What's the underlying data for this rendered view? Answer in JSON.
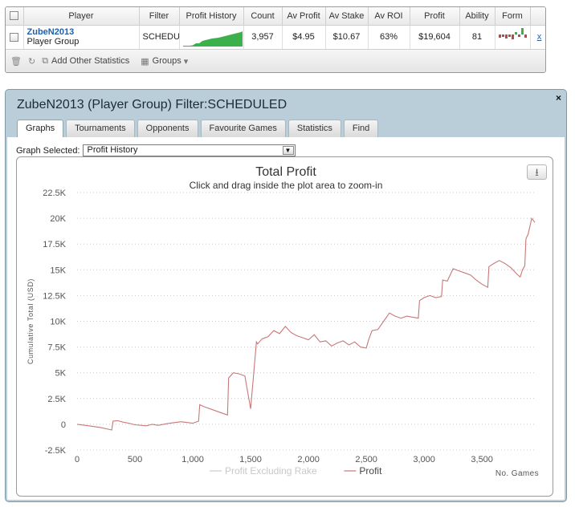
{
  "stats": {
    "headers": [
      "Player",
      "Filter",
      "Profit History",
      "Count",
      "Av Profit",
      "Av Stake",
      "Av ROI",
      "Profit",
      "Ability",
      "Form"
    ],
    "row": {
      "player_name": "ZubeN2013",
      "player_type": "Player Group",
      "filter": "SCHEDULED",
      "count": "3,957",
      "av_profit": "$4.95",
      "av_stake": "$10.67",
      "av_roi": "63%",
      "profit": "$19,604",
      "ability": "81",
      "remove": "x"
    },
    "form_colors": {
      "negative": "#b84a4a",
      "positive": "#3cb04a"
    },
    "toolbar": {
      "add_stats": "Add Other Statistics",
      "groups": "Groups"
    },
    "icons": [
      "trash-icon",
      "refresh-icon",
      "add-stats-icon",
      "groups-icon",
      "chevron-down-icon"
    ]
  },
  "panel": {
    "title": "ZubeN2013 (Player Group) Filter:SCHEDULED",
    "close": "×",
    "tabs": [
      {
        "label": "Graphs",
        "active": true
      },
      {
        "label": "Tournaments",
        "active": false
      },
      {
        "label": "Opponents",
        "active": false
      },
      {
        "label": "Favourite Games",
        "active": false
      },
      {
        "label": "Statistics",
        "active": false
      },
      {
        "label": "Find",
        "active": false
      }
    ],
    "graph_selected_label": "Graph Selected:",
    "graph_selected_value": "Profit History"
  },
  "chart_data": {
    "type": "line",
    "title": "Total Profit",
    "subtitle": "Click and drag inside the plot area to zoom-in",
    "xlabel": "No. Games",
    "ylabel": "Cumulative Total (USD)",
    "xlim": [
      0,
      3957
    ],
    "ylim": [
      -2500,
      22500
    ],
    "x_ticks": [
      0,
      500,
      1000,
      1500,
      2000,
      2500,
      3000,
      3500
    ],
    "x_tick_labels": [
      "0",
      "500",
      "1,000",
      "1,500",
      "2,000",
      "2,500",
      "3,000",
      "3,500"
    ],
    "y_ticks": [
      -2500,
      0,
      2500,
      5000,
      7500,
      10000,
      12500,
      15000,
      17500,
      20000,
      22500
    ],
    "y_tick_labels": [
      "-2.5K",
      "0",
      "2.5K",
      "5K",
      "7.5K",
      "10K",
      "12.5K",
      "15K",
      "17.5K",
      "20K",
      "22.5K"
    ],
    "grid": true,
    "legend_position": "bottom",
    "series": [
      {
        "name": "Profit Excluding Rake",
        "color": "#dddddd",
        "visible": false,
        "x": [],
        "y": []
      },
      {
        "name": "Profit",
        "color": "#c87878",
        "visible": true,
        "x": [
          0,
          100,
          200,
          300,
          310,
          350,
          400,
          450,
          500,
          600,
          650,
          700,
          800,
          900,
          1000,
          1050,
          1060,
          1100,
          1200,
          1250,
          1300,
          1310,
          1350,
          1400,
          1450,
          1500,
          1550,
          1560,
          1600,
          1650,
          1700,
          1750,
          1800,
          1850,
          1900,
          1950,
          2000,
          2050,
          2100,
          2150,
          2200,
          2250,
          2300,
          2350,
          2400,
          2450,
          2500,
          2520,
          2550,
          2600,
          2650,
          2700,
          2750,
          2800,
          2850,
          2900,
          2950,
          2960,
          3000,
          3050,
          3100,
          3150,
          3160,
          3200,
          3250,
          3300,
          3350,
          3400,
          3450,
          3500,
          3550,
          3560,
          3600,
          3650,
          3700,
          3750,
          3800,
          3830,
          3850,
          3870,
          3880,
          3900,
          3930,
          3957
        ],
        "y": [
          0,
          -150,
          -300,
          -550,
          300,
          350,
          200,
          100,
          -50,
          -150,
          0,
          -100,
          100,
          250,
          100,
          300,
          1900,
          1700,
          1300,
          1100,
          900,
          4500,
          5000,
          4900,
          4700,
          1500,
          8000,
          7800,
          8300,
          8500,
          9100,
          8800,
          9500,
          8900,
          8600,
          8400,
          8200,
          8700,
          8000,
          8100,
          7600,
          7900,
          8100,
          7700,
          8000,
          7500,
          7400,
          8200,
          9100,
          9200,
          10000,
          10800,
          10500,
          10300,
          10500,
          10400,
          10300,
          12000,
          12300,
          12500,
          12300,
          12400,
          14000,
          13900,
          15100,
          14900,
          14700,
          14500,
          14000,
          13600,
          13300,
          15300,
          15600,
          15900,
          15600,
          15200,
          14600,
          14300,
          15000,
          15400,
          18000,
          18500,
          20000,
          19604
        ]
      }
    ]
  }
}
